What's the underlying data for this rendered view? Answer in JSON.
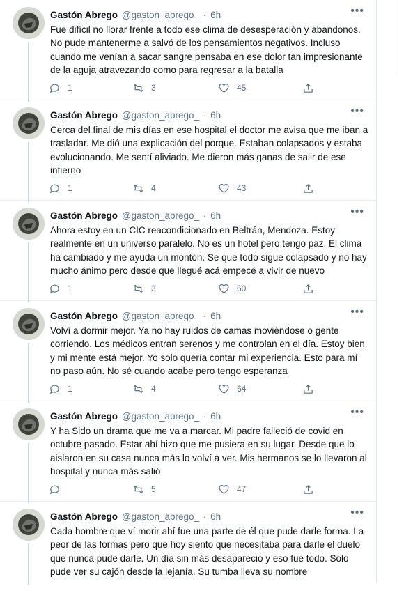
{
  "tweets": [
    {
      "name": "Gastón Abrego",
      "handle": "@gaston_abrego_",
      "separator": "·",
      "time": "6h",
      "text": "Fue difícil no llorar frente a todo ese clima de desesperación y abandonos. No pude mantenerme a salvó de los pensamientos negativos. Incluso cuando me venían a sacar sangre pensaba en ese dolor tan impresionante de la aguja atravezando como para regresar a la batalla",
      "replies": "1",
      "retweets": "3",
      "likes": "45"
    },
    {
      "name": "Gastón Abrego",
      "handle": "@gaston_abrego_",
      "separator": "·",
      "time": "6h",
      "text": "Cerca del final de mis días en ese hospital el doctor me avisa que me iban a trasladar. Me dió una explicación del porque. Estaban colapsados y estaba evolucionando. Me sentí aliviado. Me dieron más ganas de salir de ese infierno",
      "replies": "1",
      "retweets": "4",
      "likes": "43"
    },
    {
      "name": "Gastón Abrego",
      "handle": "@gaston_abrego_",
      "separator": "·",
      "time": "6h",
      "text": "Ahora estoy en un CIC reacondicionado en Beltrán, Mendoza. Estoy realmente en un universo paralelo. No es un hotel pero tengo paz. El clima ha cambiado y me ayuda un montón. Se que todo sigue colapsado y no hay mucho ánimo pero desde que llegué acá empecé a vivir de nuevo",
      "replies": "1",
      "retweets": "3",
      "likes": "60"
    },
    {
      "name": "Gastón Abrego",
      "handle": "@gaston_abrego_",
      "separator": "·",
      "time": "6h",
      "text": "Volví a dormir mejor. Ya no hay ruidos de camas moviéndose o gente corriendo. Los médicos entran serenos y me controlan en el día. Estoy bien y mi mente está mejor. Yo solo quería contar mi experiencia. Esto para mí no paso aún. No sé cuando acabe pero tengo esperanza",
      "replies": "1",
      "retweets": "4",
      "likes": "64"
    },
    {
      "name": "Gastón Abrego",
      "handle": "@gaston_abrego_",
      "separator": "·",
      "time": "6h",
      "text": "Y ha Sido un drama que me va a marcar. Mi padre falleció de covid en octubre pasado. Estar ahí hizo que me pusiera en su lugar. Desde que lo aislaron en su casa nunca más lo volví a ver. Mis hermanos se lo llevaron al hospital y nunca más salió",
      "replies": "",
      "retweets": "5",
      "likes": "47"
    },
    {
      "name": "Gastón Abrego",
      "handle": "@gaston_abrego_",
      "separator": "·",
      "time": "6h",
      "text": "Cada hombre que ví morir ahí fue una parte de él que pude darle forma. La peor de las formas pero que hoy siento que necesitaba para darle el duelo que nunca pude darle. Un día sin más desapareció y eso fue todo. Solo pude ver su cajón desde la lejanía. Su tumba lleva su nombre",
      "replies": "",
      "retweets": "",
      "likes": ""
    }
  ]
}
